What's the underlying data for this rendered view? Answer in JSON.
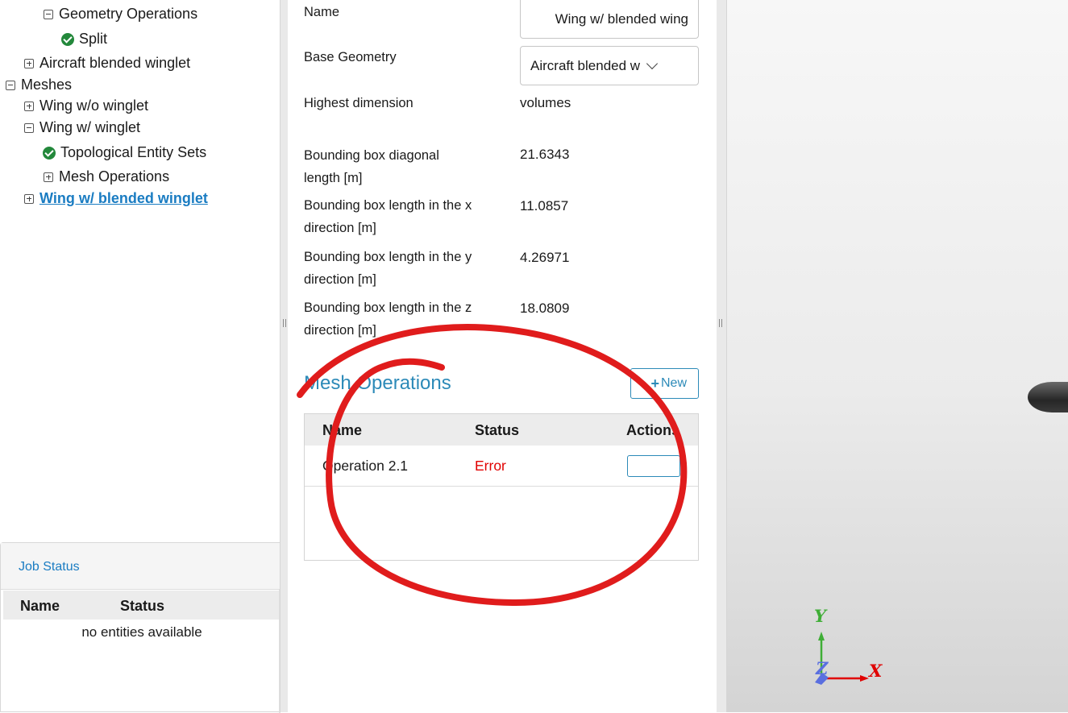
{
  "tree": {
    "items": [
      {
        "label": "Geometry Operations",
        "type": "collapse"
      },
      {
        "label": "Split",
        "type": "ok"
      },
      {
        "label": "Aircraft blended winglet",
        "type": "expand"
      },
      {
        "label": "Meshes",
        "type": "collapse"
      },
      {
        "label": "Wing w/o winglet",
        "type": "expand"
      },
      {
        "label": "Wing w/ winglet",
        "type": "collapse"
      },
      {
        "label": "Topological Entity Sets",
        "type": "ok"
      },
      {
        "label": "Mesh Operations",
        "type": "expand"
      },
      {
        "label": "Wing w/ blended winglet",
        "type": "expand",
        "selected": true
      }
    ]
  },
  "job_status": {
    "title": "Job Status",
    "columns": [
      "Name",
      "Status"
    ],
    "empty_text": "no entities available"
  },
  "properties": {
    "name_label": "Name",
    "name_value": "Wing w/ blended wing",
    "base_geometry_label": "Base Geometry",
    "base_geometry_value": "Aircraft blended w",
    "highest_dimension_label": "Highest dimension",
    "highest_dimension_value": "volumes",
    "diag_label": "Bounding box diagonal length [m]",
    "diag_value": "21.6343",
    "x_label": "Bounding box length in the x direction [m]",
    "x_value": "11.0857",
    "y_label": "Bounding box length in the y direction [m]",
    "y_value": "4.26971",
    "z_label": "Bounding box length in the z direction [m]",
    "z_value": "18.0809"
  },
  "mesh_operations": {
    "title": "Mesh Operations",
    "new_label": "New",
    "columns": [
      "Name",
      "Status",
      "Actions"
    ],
    "rows": [
      {
        "name": "Operation 2.1",
        "status": "Error"
      }
    ]
  },
  "viewport": {
    "axes": {
      "x": "X",
      "y": "Y",
      "z": "Z"
    },
    "colors": {
      "x": "#e00000",
      "y": "#3fae36",
      "z": "#5a6fe0"
    }
  },
  "colors": {
    "accent": "#2c8ab8",
    "error": "#e10000",
    "annotation": "#e01c1c",
    "ok": "#23883b"
  }
}
